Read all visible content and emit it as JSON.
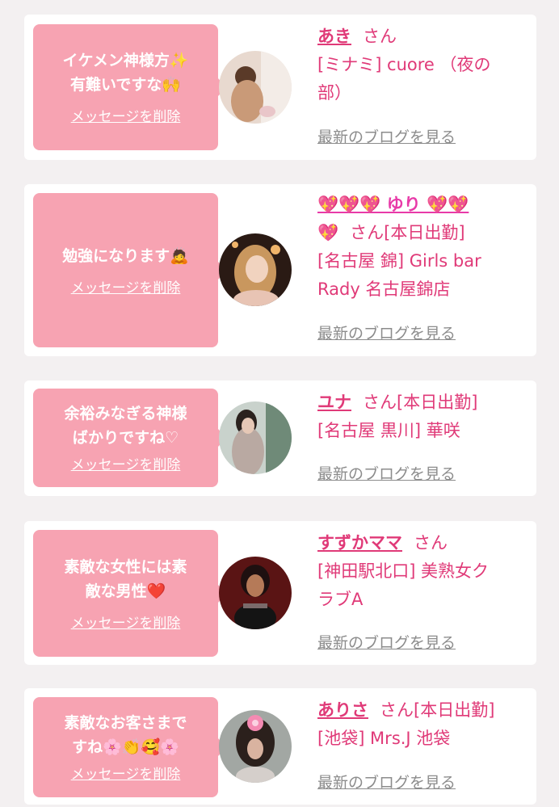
{
  "entries": [
    {
      "message_lines": [
        "イケメン神様方✨",
        "有難いですな🙌"
      ],
      "delete_label": "メッセージを削除",
      "name": "あき",
      "suffix": "さん",
      "shop_lines": [
        "[ミナミ] cuore （夜の",
        "部）"
      ],
      "blog_label": "最新のブログを見る"
    },
    {
      "message_lines": [
        "勉強になります🙇"
      ],
      "delete_label": "メッセージを削除",
      "name": "💖💖💖 ゆり 💖💖",
      "name_cont": "💖",
      "suffix": "さん[本日出勤]",
      "shop_lines": [
        "[名古屋 錦] Girls bar",
        "Rady 名古屋錦店"
      ],
      "blog_label": "最新のブログを見る"
    },
    {
      "message_lines": [
        "余裕みなぎる神様",
        "ばかりですね♡"
      ],
      "delete_label": "メッセージを削除",
      "name": "ユナ",
      "suffix": "さん[本日出勤]",
      "shop_lines": [
        "[名古屋 黒川] 華咲"
      ],
      "blog_label": "最新のブログを見る"
    },
    {
      "message_lines": [
        "素敵な女性には素",
        "敵な男性❤️"
      ],
      "delete_label": "メッセージを削除",
      "name": "すずかママ",
      "suffix": "さん",
      "shop_lines": [
        "[神田駅北口] 美熟女ク",
        "ラブA"
      ],
      "blog_label": "最新のブログを見る"
    },
    {
      "message_lines": [
        "素敵なお客さまで",
        "すね🌸👏🥰🌸"
      ],
      "delete_label": "メッセージを削除",
      "name": "ありさ",
      "suffix": "さん[本日出勤]",
      "shop_lines": [
        "[池袋] Mrs.J 池袋"
      ],
      "blog_label": "最新のブログを見る"
    }
  ],
  "colors": {
    "accent_pink": "#f7a3b2",
    "name_pink": "#e03a78",
    "link_gray": "#8c8c8c",
    "background": "#f3f0f1"
  }
}
